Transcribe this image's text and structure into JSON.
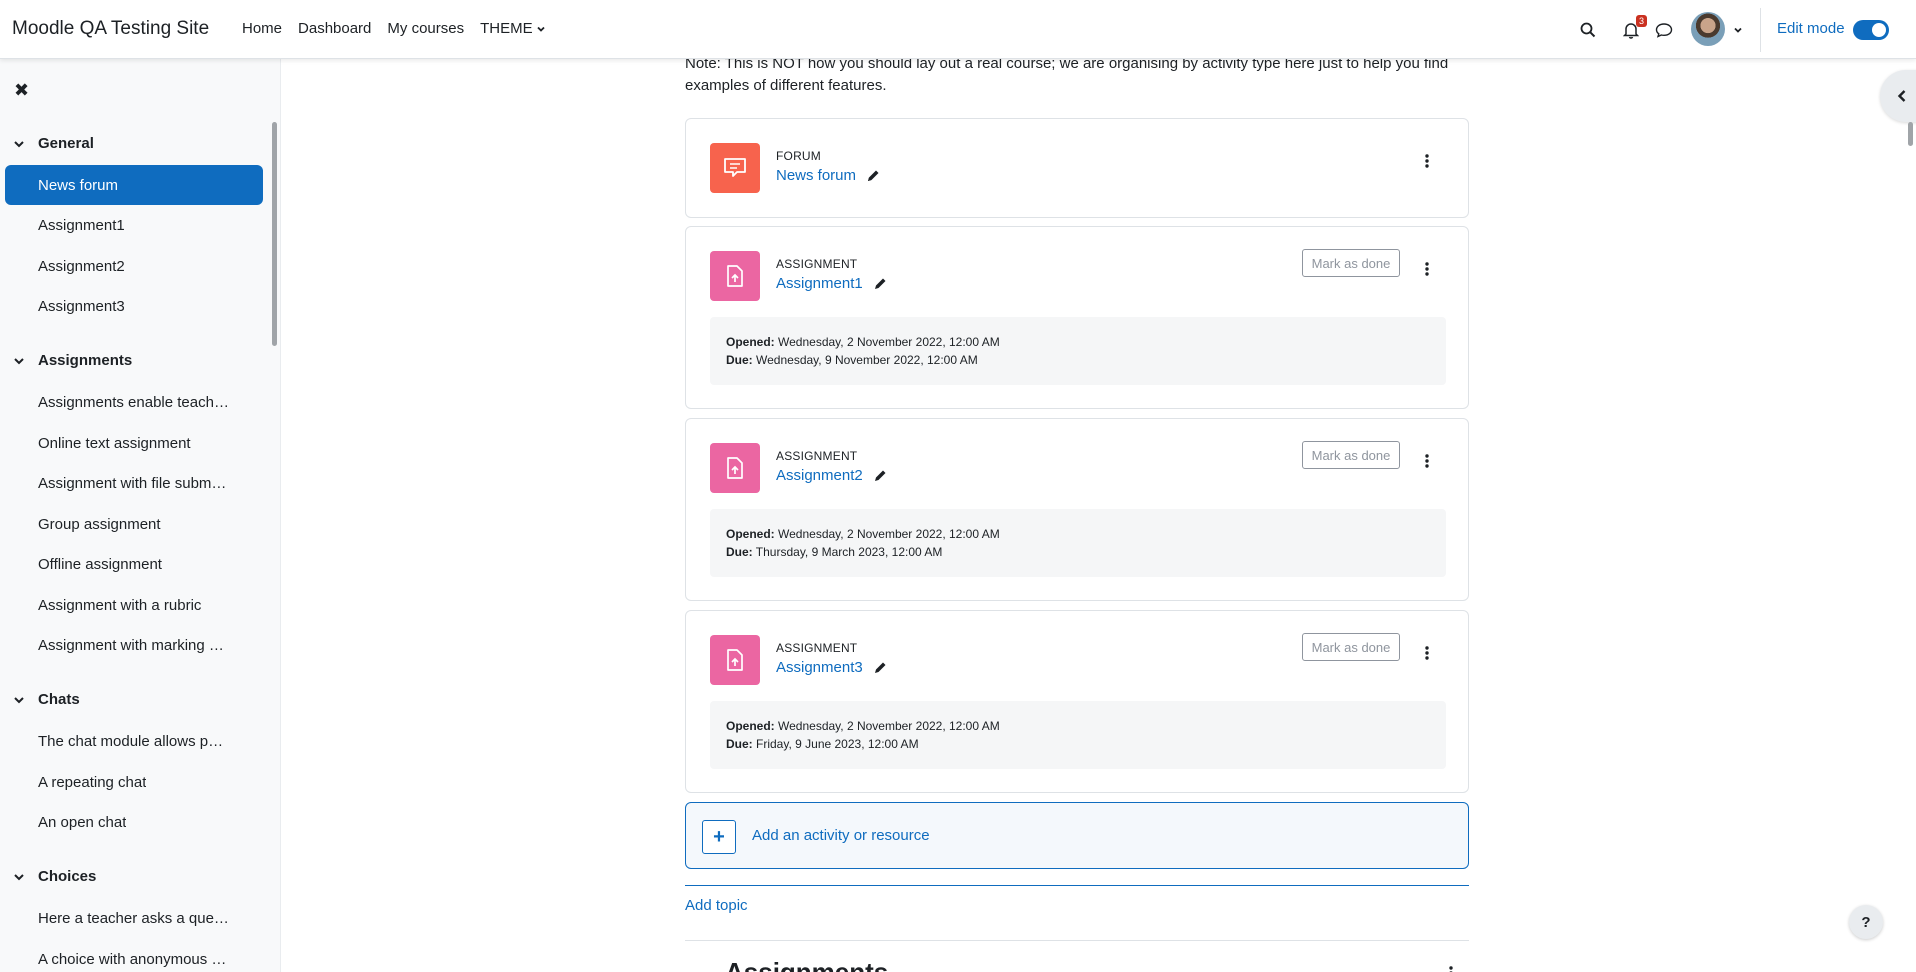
{
  "navbar": {
    "site_name": "Moodle QA Testing Site",
    "links": [
      "Home",
      "Dashboard",
      "My courses",
      "THEME"
    ],
    "notification_count": "3",
    "edit_mode_label": "Edit mode",
    "edit_mode_on": true
  },
  "drawer": {
    "sections": [
      {
        "title": "General",
        "items": [
          "News forum",
          "Assignment1",
          "Assignment2",
          "Assignment3"
        ]
      },
      {
        "title": "Assignments",
        "items": [
          "Assignments enable teach…",
          "Online text assignment",
          "Assignment with file subm…",
          "Group assignment",
          "Offline assignment",
          "Assignment with a rubric",
          "Assignment with marking …"
        ]
      },
      {
        "title": "Chats",
        "items": [
          "The chat module allows p…",
          "A repeating chat",
          "An open chat"
        ]
      },
      {
        "title": "Choices",
        "items": [
          "Here a teacher asks a que…",
          "A choice with anonymous …"
        ]
      }
    ],
    "active_item": "News forum"
  },
  "main": {
    "note": "Note: This is NOT how you should lay out a real course; we are organising by activity type here just to help you find examples of different features.",
    "activities": [
      {
        "type": "FORUM",
        "name": "News forum",
        "color": "#f7634d",
        "icon": "forum-icon"
      },
      {
        "type": "ASSIGNMENT",
        "name": "Assignment1",
        "color": "#eb66a2",
        "icon": "assignment-icon",
        "mark_done": "Mark as done",
        "opened_label": "Opened:",
        "opened": "Wednesday, 2 November 2022, 12:00 AM",
        "due_label": "Due:",
        "due": "Wednesday, 9 November 2022, 12:00 AM"
      },
      {
        "type": "ASSIGNMENT",
        "name": "Assignment2",
        "color": "#eb66a2",
        "icon": "assignment-icon",
        "mark_done": "Mark as done",
        "opened_label": "Opened:",
        "opened": "Wednesday, 2 November 2022, 12:00 AM",
        "due_label": "Due:",
        "due": "Thursday, 9 March 2023, 12:00 AM"
      },
      {
        "type": "ASSIGNMENT",
        "name": "Assignment3",
        "color": "#eb66a2",
        "icon": "assignment-icon",
        "mark_done": "Mark as done",
        "opened_label": "Opened:",
        "opened": "Wednesday, 2 November 2022, 12:00 AM",
        "due_label": "Due:",
        "due": "Friday, 9 June 2023, 12:00 AM"
      }
    ],
    "add_activity": "Add an activity or resource",
    "add_topic": "Add topic",
    "next_section_title": "Assignments"
  },
  "help_label": "?"
}
